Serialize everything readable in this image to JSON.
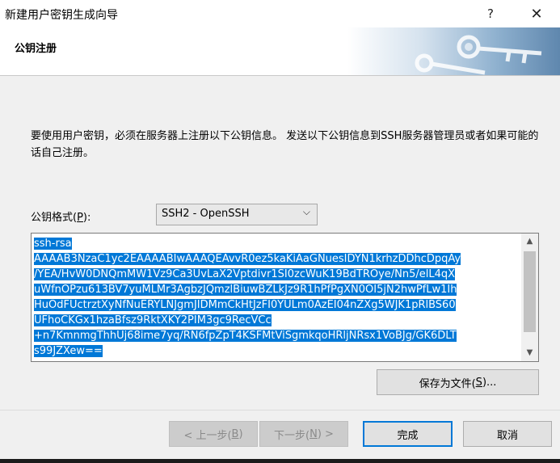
{
  "window": {
    "title": "新建用户密钥生成向导",
    "help_glyph": "?",
    "close_glyph": "✕"
  },
  "header": {
    "title": "公钥注册"
  },
  "description": "要使用用户密钥，必须在服务器上注册以下公钥信息。 发送以下公钥信息到SSH服务器管理员或者如果可能的话自己注册。",
  "format": {
    "label_prefix": "公钥格式(",
    "label_accel": "P",
    "label_suffix": "):",
    "selected": "SSH2 - OpenSSH",
    "arrow": "⌵"
  },
  "public_key_lines": [
    "ssh-rsa",
    "AAAAB3NzaC1yc2EAAAABIwAAAQEAvvR0ez5kaKiAaGNuesIDYN1krhzDDhcDpqAy",
    "/YEA/HvW0DNQmMW1Vz9Ca3UvLaX2Vptdivr1SI0zcWuK19BdTROye/Nn5/elL4qX",
    "uWfnOPzu613BV7yuMLMr3AgbzJQmzlBiuwBZLkJz9R1hPfPgXN0OI5jN2hwPfLw1Ih",
    "HuOdFUctrztXyNfNuERYLNJgmJIDMmCkHtJzFI0YULm0AzEI04nZXg5WJK1pRlBS60",
    "UFhoCKGx1hzaBfsz9RktXKY2PIM3gc9RecVCc",
    "+n7KmnmgThhUj68ime7yq/RN6fpZpT4KSFMtViSgmkqoHRljNRsx1VoBJg/GK6DLT",
    "s99JZXew=="
  ],
  "scrollbar": {
    "up_glyph": "▲",
    "down_glyph": "▼"
  },
  "buttons": {
    "save_prefix": "保存为文件(",
    "save_accel": "S",
    "save_suffix": ")...",
    "back_prefix": "< 上一步(",
    "back_accel": "B",
    "back_suffix": ")",
    "next_prefix": "下一步(",
    "next_accel": "N",
    "next_suffix": ") >",
    "finish": "完成",
    "cancel": "取消"
  },
  "colors": {
    "selection": "#0078d7",
    "default_button_border": "#0078d7"
  }
}
